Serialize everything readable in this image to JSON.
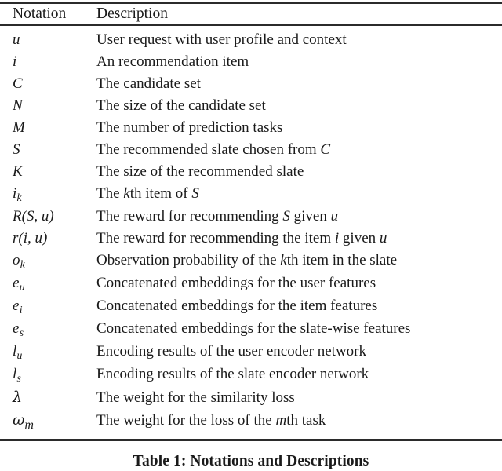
{
  "figure": {
    "caption": "Table 1: Notations and Descriptions",
    "rule_color": "#2b2b2b",
    "text_color": "#1a1a1a",
    "background": "#ffffff"
  },
  "table": {
    "headers": {
      "notation": "Notation",
      "description": "Description"
    },
    "rows": [
      {
        "notation": "u",
        "notation_plain": "u",
        "description": "User request with user profile and context"
      },
      {
        "notation": "i",
        "notation_plain": "i",
        "description": "An recommendation item"
      },
      {
        "notation": "C",
        "notation_plain": "C",
        "description": "The candidate set"
      },
      {
        "notation": "N",
        "notation_plain": "N",
        "description": "The size of the candidate set"
      },
      {
        "notation": "M",
        "notation_plain": "M",
        "description": "The number of prediction tasks"
      },
      {
        "notation": "S",
        "notation_plain": "S",
        "description": "The recommended slate chosen from C"
      },
      {
        "notation": "K",
        "notation_plain": "K",
        "description": "The size of the recommended slate"
      },
      {
        "notation": "i_k",
        "notation_plain": "ik",
        "description": "The kth item of S"
      },
      {
        "notation": "R(S, u)",
        "notation_plain": "R(S,u)",
        "description": "The reward for recommending S given u"
      },
      {
        "notation": "r(i, u)",
        "notation_plain": "r(i,u)",
        "description": "The reward for recommending the item i given u"
      },
      {
        "notation": "o_k",
        "notation_plain": "ok",
        "description": "Observation probability of the kth item in the slate"
      },
      {
        "notation": "e_u",
        "notation_plain": "eu",
        "description": "Concatenated embeddings for the user features"
      },
      {
        "notation": "e_i",
        "notation_plain": "ei",
        "description": "Concatenated embeddings for the item features"
      },
      {
        "notation": "e_s",
        "notation_plain": "es",
        "description": "Concatenated embeddings for the slate-wise features"
      },
      {
        "notation": "l_u",
        "notation_plain": "lu",
        "description": "Encoding results of the user encoder network"
      },
      {
        "notation": "l_s",
        "notation_plain": "ls",
        "description": "Encoding results of the slate encoder network"
      },
      {
        "notation": "lambda",
        "notation_plain": "λ",
        "description": "The weight for the similarity loss"
      },
      {
        "notation": "omega_m",
        "notation_plain": "ωm",
        "description": "The weight for the loss of the mth task"
      }
    ]
  },
  "notation_glyphs": {
    "0": {
      "base": "u",
      "sub": ""
    },
    "1": {
      "base": "i",
      "sub": ""
    },
    "2": {
      "base": "C",
      "sub": ""
    },
    "3": {
      "base": "N",
      "sub": ""
    },
    "4": {
      "base": "M",
      "sub": ""
    },
    "5": {
      "base": "S",
      "sub": ""
    },
    "6": {
      "base": "K",
      "sub": ""
    },
    "7": {
      "base": "i",
      "sub": "k"
    },
    "8": {
      "base": "R(S, u)",
      "sub": ""
    },
    "9": {
      "base": "r(i, u)",
      "sub": ""
    },
    "10": {
      "base": "o",
      "sub": "k"
    },
    "11": {
      "base": "e",
      "sub": "u"
    },
    "12": {
      "base": "e",
      "sub": "i"
    },
    "13": {
      "base": "e",
      "sub": "s"
    },
    "14": {
      "base": "l",
      "sub": "u"
    },
    "15": {
      "base": "l",
      "sub": "s"
    },
    "16": {
      "base": "λ",
      "sub": ""
    },
    "17": {
      "base": "ω",
      "sub": "m"
    }
  },
  "description_parts": {
    "0": [
      {
        "t": "User request with user profile and context",
        "i": false
      }
    ],
    "1": [
      {
        "t": "An recommendation item",
        "i": false
      }
    ],
    "2": [
      {
        "t": "The candidate set",
        "i": false
      }
    ],
    "3": [
      {
        "t": "The size of the candidate set",
        "i": false
      }
    ],
    "4": [
      {
        "t": "The number of prediction tasks",
        "i": false
      }
    ],
    "5": [
      {
        "t": "The recommended slate chosen from ",
        "i": false
      },
      {
        "t": "C",
        "i": true
      }
    ],
    "6": [
      {
        "t": "The size of the recommended slate",
        "i": false
      }
    ],
    "7": [
      {
        "t": "The ",
        "i": false
      },
      {
        "t": "k",
        "i": true
      },
      {
        "t": "th item of ",
        "i": false
      },
      {
        "t": "S",
        "i": true
      }
    ],
    "8": [
      {
        "t": "The reward for recommending ",
        "i": false
      },
      {
        "t": "S",
        "i": true
      },
      {
        "t": " given ",
        "i": false
      },
      {
        "t": "u",
        "i": true
      }
    ],
    "9": [
      {
        "t": "The reward for recommending the item ",
        "i": false
      },
      {
        "t": "i",
        "i": true
      },
      {
        "t": " given ",
        "i": false
      },
      {
        "t": "u",
        "i": true
      }
    ],
    "10": [
      {
        "t": "Observation probability of the ",
        "i": false
      },
      {
        "t": "k",
        "i": true
      },
      {
        "t": "th item in the slate",
        "i": false
      }
    ],
    "11": [
      {
        "t": "Concatenated embeddings for the user features",
        "i": false
      }
    ],
    "12": [
      {
        "t": "Concatenated embeddings for the item features",
        "i": false
      }
    ],
    "13": [
      {
        "t": "Concatenated embeddings for the slate-wise features",
        "i": false
      }
    ],
    "14": [
      {
        "t": "Encoding results of the user encoder network",
        "i": false
      }
    ],
    "15": [
      {
        "t": "Encoding results of the slate encoder network",
        "i": false
      }
    ],
    "16": [
      {
        "t": "The weight for the similarity loss",
        "i": false
      }
    ],
    "17": [
      {
        "t": "The weight for the loss of the ",
        "i": false
      },
      {
        "t": "m",
        "i": true
      },
      {
        "t": "th task",
        "i": false
      }
    ]
  }
}
